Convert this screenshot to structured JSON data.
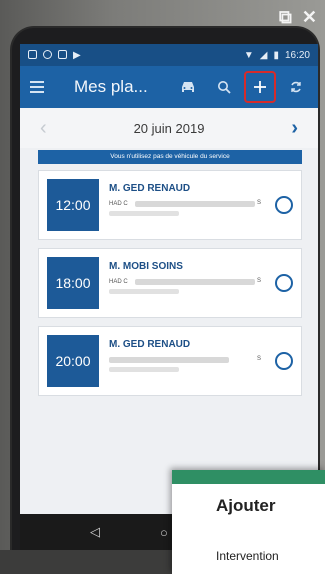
{
  "statusbar": {
    "time": "16:20"
  },
  "appbar": {
    "title": "Mes pla..."
  },
  "datenav": {
    "date": "20 juin 2019"
  },
  "banner": {
    "text": "Vous n'utilisez pas de véhicule du service"
  },
  "appointments": [
    {
      "time": "12:00",
      "name": "M. GED RENAUD",
      "detail": "HAD C",
      "suffix": "S"
    },
    {
      "time": "18:00",
      "name": "M. MOBI SOINS",
      "detail": "HAD C",
      "suffix": "S"
    },
    {
      "time": "20:00",
      "name": "M. GED RENAUD",
      "detail": "",
      "suffix": "S"
    }
  ],
  "popup": {
    "title": "Ajouter",
    "item": "Intervention"
  },
  "colors": {
    "primary": "#1d62a5",
    "statusbar": "#184f86",
    "highlight": "#d62b2b"
  }
}
